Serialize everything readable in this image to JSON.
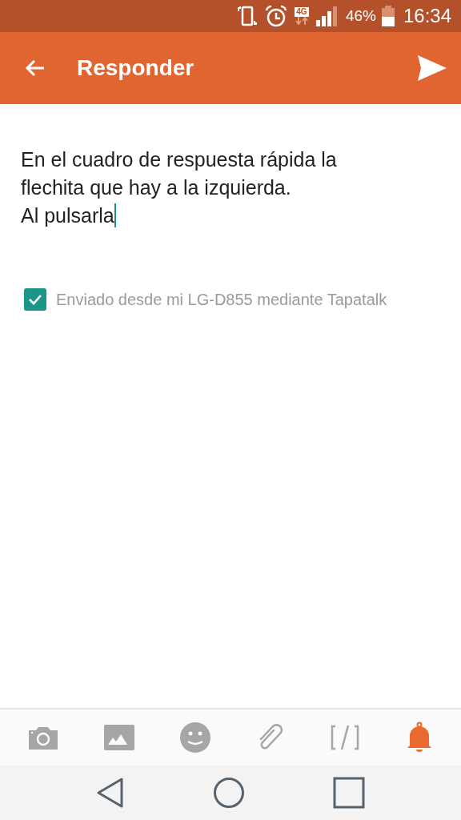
{
  "status_bar": {
    "network": "4G",
    "battery": "46%",
    "time": "16:34"
  },
  "app_bar": {
    "title": "Responder"
  },
  "message": {
    "value_lines": [
      "En el cuadro de respuesta rápida la",
      "flechita que hay a la izquierda.",
      "Al pulsarla"
    ]
  },
  "signature": {
    "label": "Enviado desde mi LG-D855 mediante Tapatalk",
    "checked": true
  },
  "toolbar": [
    {
      "kind": "camera",
      "on": false
    },
    {
      "kind": "image",
      "on": false
    },
    {
      "kind": "emoji",
      "on": false
    },
    {
      "kind": "attach",
      "on": false
    },
    {
      "kind": "code",
      "on": false
    },
    {
      "kind": "bell",
      "on": true
    }
  ]
}
